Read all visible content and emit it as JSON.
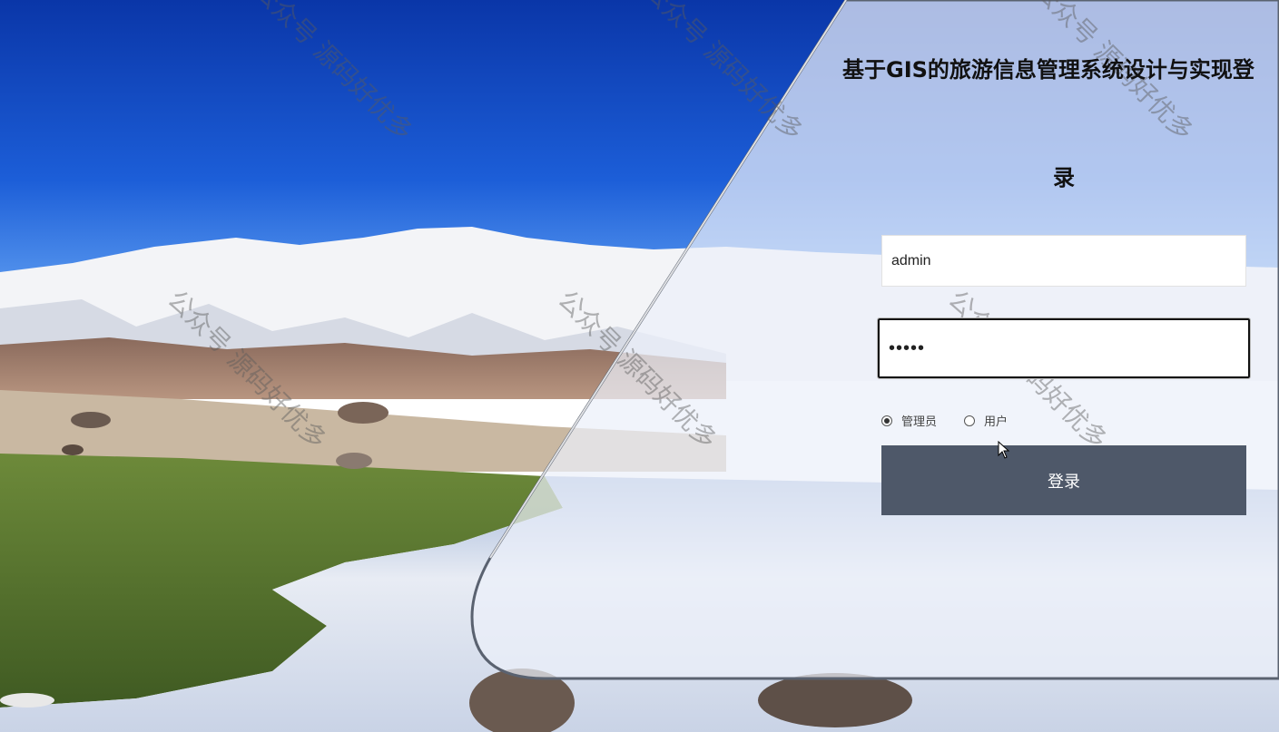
{
  "login": {
    "title": "基于GIS的旅游信息管理系统设计与实现登",
    "title_tail": "录",
    "username_value": "admin",
    "password_value": "•••••",
    "roles": [
      {
        "label": "管理员",
        "checked": true
      },
      {
        "label": "用户",
        "checked": false
      }
    ],
    "login_label": "登录"
  },
  "watermark": {
    "text": "公众号 源码好优多"
  },
  "colors": {
    "button": "#4e5869",
    "sky": "#0b3fb3"
  }
}
